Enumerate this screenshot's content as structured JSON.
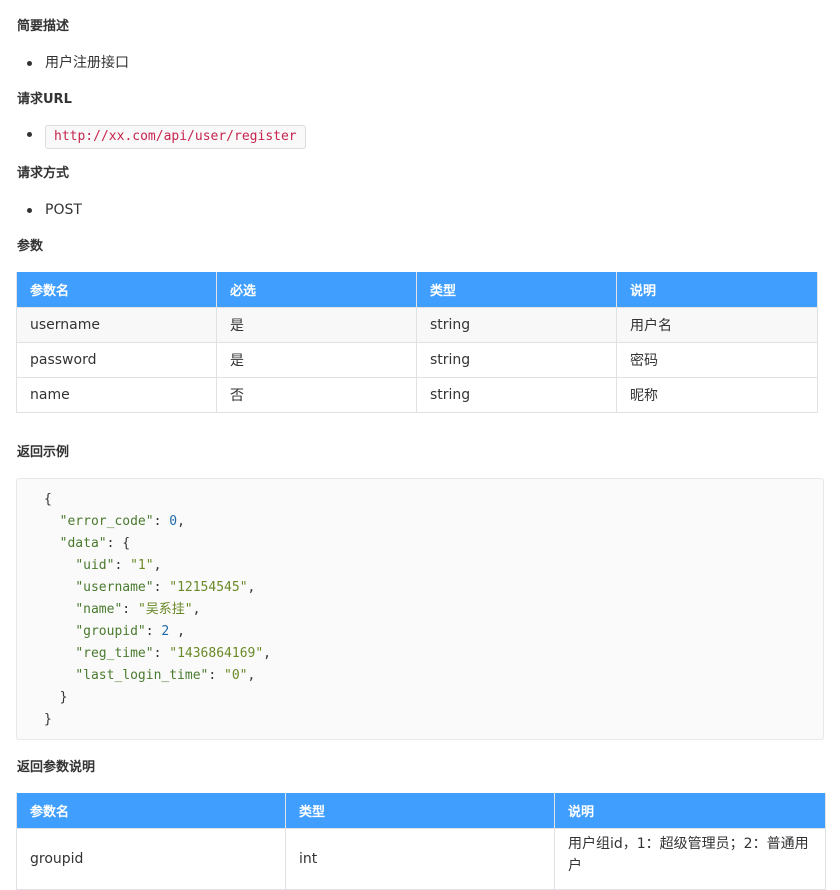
{
  "sections": {
    "desc_title": "简要描述",
    "desc_item": "用户注册接口",
    "url_title": "请求URL",
    "url_value": "http://xx.com/api/user/register",
    "method_title": "请求方式",
    "method_value": "POST",
    "params_title": "参数",
    "return_example_title": "返回示例",
    "return_params_title": "返回参数说明"
  },
  "params_table": {
    "headers": [
      "参数名",
      "必选",
      "类型",
      "说明"
    ],
    "rows": [
      [
        "username",
        "是",
        "string",
        "用户名"
      ],
      [
        "password",
        "是",
        "string",
        "密码"
      ],
      [
        "name",
        "否",
        "string",
        "昵称"
      ]
    ]
  },
  "return_example": {
    "open_brace": "{",
    "error_code_key": "\"error_code\"",
    "error_code_val": "0",
    "data_key": "\"data\"",
    "uid_key": "\"uid\"",
    "uid_val": "\"1\"",
    "username_key": "\"username\"",
    "username_val": "\"12154545\"",
    "name_key": "\"name\"",
    "name_val": "\"吴系挂\"",
    "groupid_key": "\"groupid\"",
    "groupid_val": "2",
    "reg_time_key": "\"reg_time\"",
    "reg_time_val": "\"1436864169\"",
    "last_login_time_key": "\"last_login_time\"",
    "last_login_time_val": "\"0\"",
    "inner_close": "}",
    "outer_close": "}"
  },
  "return_table": {
    "headers": [
      "参数名",
      "类型",
      "说明"
    ],
    "rows": [
      [
        "groupid",
        "int",
        "用户组id，1：超级管理员；2：普通用户"
      ]
    ]
  }
}
